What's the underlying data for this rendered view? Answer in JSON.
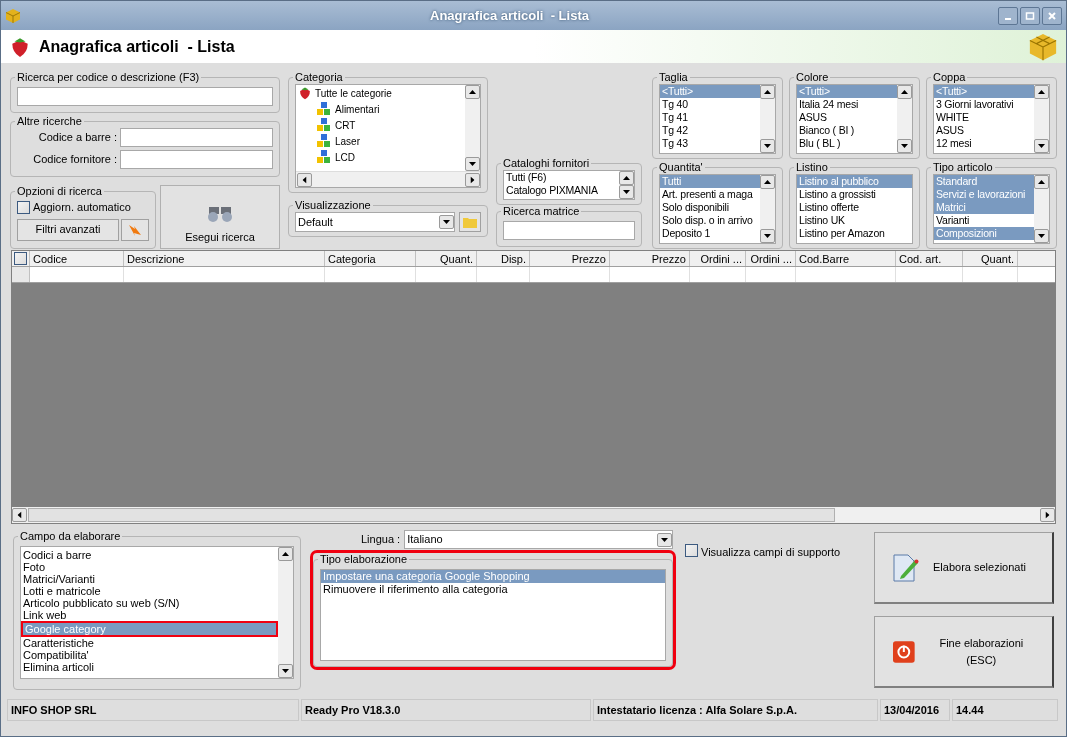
{
  "window": {
    "title": "Anagrafica articoli  - Lista"
  },
  "header": {
    "title": "Anagrafica articoli  - Lista"
  },
  "search_box": {
    "title": "Ricerca per codice o descrizione (F3)"
  },
  "other_searches": {
    "title": "Altre ricerche",
    "fields": [
      {
        "label": "Codice a barre :"
      },
      {
        "label": "Codice fornitore :"
      }
    ]
  },
  "search_options": {
    "title": "Opzioni di ricerca",
    "auto_update": {
      "label": "Aggiorn. automatico",
      "checked": false
    },
    "advanced_button": "Filtri avanzati"
  },
  "run_search_button": "Esegui ricerca",
  "category": {
    "title": "Categoria",
    "root": {
      "label": "Tutte le categorie",
      "children": [
        {
          "label": "Alimentari"
        },
        {
          "label": "CRT"
        },
        {
          "label": "Laser"
        },
        {
          "label": "LCD"
        }
      ]
    }
  },
  "view": {
    "title": "Visualizzazione",
    "value": "Default"
  },
  "supplier_catalogs": {
    "title": "Cataloghi fornitori",
    "items": [
      {
        "label": "Tutti (F6)",
        "selected": false
      },
      {
        "label": "Catalogo PIXMANIA",
        "selected": false
      }
    ]
  },
  "matrix_search": {
    "title": "Ricerca matrice"
  },
  "filter_lists": [
    {
      "title": "Taglia",
      "scrollable": true,
      "items": [
        {
          "label": "<Tutti>",
          "selected": true
        },
        {
          "label": "Tg 40",
          "selected": false
        },
        {
          "label": "Tg 41",
          "selected": false
        },
        {
          "label": "Tg 42",
          "selected": false
        },
        {
          "label": "Tg 43",
          "selected": false
        }
      ]
    },
    {
      "title": "Colore",
      "scrollable": true,
      "items": [
        {
          "label": "<Tutti>",
          "selected": true
        },
        {
          "label": "Italia 24 mesi",
          "selected": false
        },
        {
          "label": "ASUS",
          "selected": false
        },
        {
          "label": "Bianco ( BI )",
          "selected": false
        },
        {
          "label": "Blu ( BL )",
          "selected": false
        }
      ]
    },
    {
      "title": "Coppa",
      "scrollable": true,
      "items": [
        {
          "label": "<Tutti>",
          "selected": true
        },
        {
          "label": "3 Giorni lavorativi",
          "selected": false
        },
        {
          "label": "WHITE",
          "selected": false
        },
        {
          "label": "ASUS",
          "selected": false
        },
        {
          "label": "12 mesi",
          "selected": false
        }
      ]
    },
    {
      "title": "Quantita'",
      "scrollable": true,
      "items": [
        {
          "label": "Tutti",
          "selected": true
        },
        {
          "label": "Art. presenti a maga",
          "selected": false
        },
        {
          "label": "Solo disponibili",
          "selected": false
        },
        {
          "label": "Solo disp. o in arrivo",
          "selected": false
        },
        {
          "label": "Deposito 1",
          "selected": false
        }
      ]
    },
    {
      "title": "Listino",
      "scrollable": false,
      "items": [
        {
          "label": "Listino al pubblico",
          "selected": true
        },
        {
          "label": "Listino a grossisti",
          "selected": false
        },
        {
          "label": "Listino offerte",
          "selected": false
        },
        {
          "label": "Listino UK",
          "selected": false
        },
        {
          "label": "Listino per Amazon",
          "selected": false
        }
      ]
    },
    {
      "title": "Tipo articolo",
      "scrollable": true,
      "items": [
        {
          "label": "Standard",
          "selected": true
        },
        {
          "label": "Servizi e lavorazioni",
          "selected": true
        },
        {
          "label": "Matrici",
          "selected": true
        },
        {
          "label": "Varianti",
          "selected": false
        },
        {
          "label": "Composizioni",
          "selected": true
        }
      ]
    }
  ],
  "grid": {
    "select_all": {
      "checked": false
    },
    "columns": [
      {
        "label": "Codice"
      },
      {
        "label": "Descrizione"
      },
      {
        "label": "Categoria"
      },
      {
        "label": "Quant."
      },
      {
        "label": "Disp."
      },
      {
        "label": "Prezzo"
      },
      {
        "label": "Prezzo"
      },
      {
        "label": "Ordini ..."
      },
      {
        "label": "Ordini ..."
      },
      {
        "label": "Cod.Barre"
      },
      {
        "label": "Cod. art."
      },
      {
        "label": "Quant."
      }
    ]
  },
  "field_to_process": {
    "title": "Campo da elaborare",
    "items": [
      {
        "label": "Codici a barre",
        "selected": false,
        "marked": false
      },
      {
        "label": "Foto",
        "selected": false,
        "marked": false
      },
      {
        "label": "Matrici/Varianti",
        "selected": false,
        "marked": false
      },
      {
        "label": "Lotti e matricole",
        "selected": false,
        "marked": false
      },
      {
        "label": "Articolo pubblicato su web (S/N)",
        "selected": false,
        "marked": false
      },
      {
        "label": "Link web",
        "selected": false,
        "marked": false
      },
      {
        "label": "Google category",
        "selected": true,
        "marked": true
      },
      {
        "label": "Caratteristiche",
        "selected": false,
        "marked": false
      },
      {
        "label": "Compatibilita'",
        "selected": false,
        "marked": false
      },
      {
        "label": "Elimina articoli",
        "selected": false,
        "marked": false
      }
    ]
  },
  "language": {
    "label": "Lingua :",
    "value": "Italiano"
  },
  "process_type": {
    "title": "Tipo elaborazione",
    "marked": true,
    "items": [
      {
        "label": "Impostare una categoria Google Shopping",
        "selected": true
      },
      {
        "label": "Rimuovere il riferimento alla categoria",
        "selected": false
      }
    ]
  },
  "show_support_fields": {
    "label": "Visualizza campi di supporto",
    "checked": false
  },
  "buttons": [
    {
      "label": "Elabora selezionati",
      "kind": "edit"
    },
    {
      "label": "Fine elaborazioni (ESC)",
      "kind": "stop"
    }
  ],
  "status_bar": [
    {
      "text": "INFO SHOP SRL"
    },
    {
      "text": "Ready Pro V18.3.0"
    },
    {
      "text": "Intestatario licenza : Alfa Solare S.p.A."
    },
    {
      "text": "13/04/2016"
    },
    {
      "text": "14.44"
    }
  ]
}
